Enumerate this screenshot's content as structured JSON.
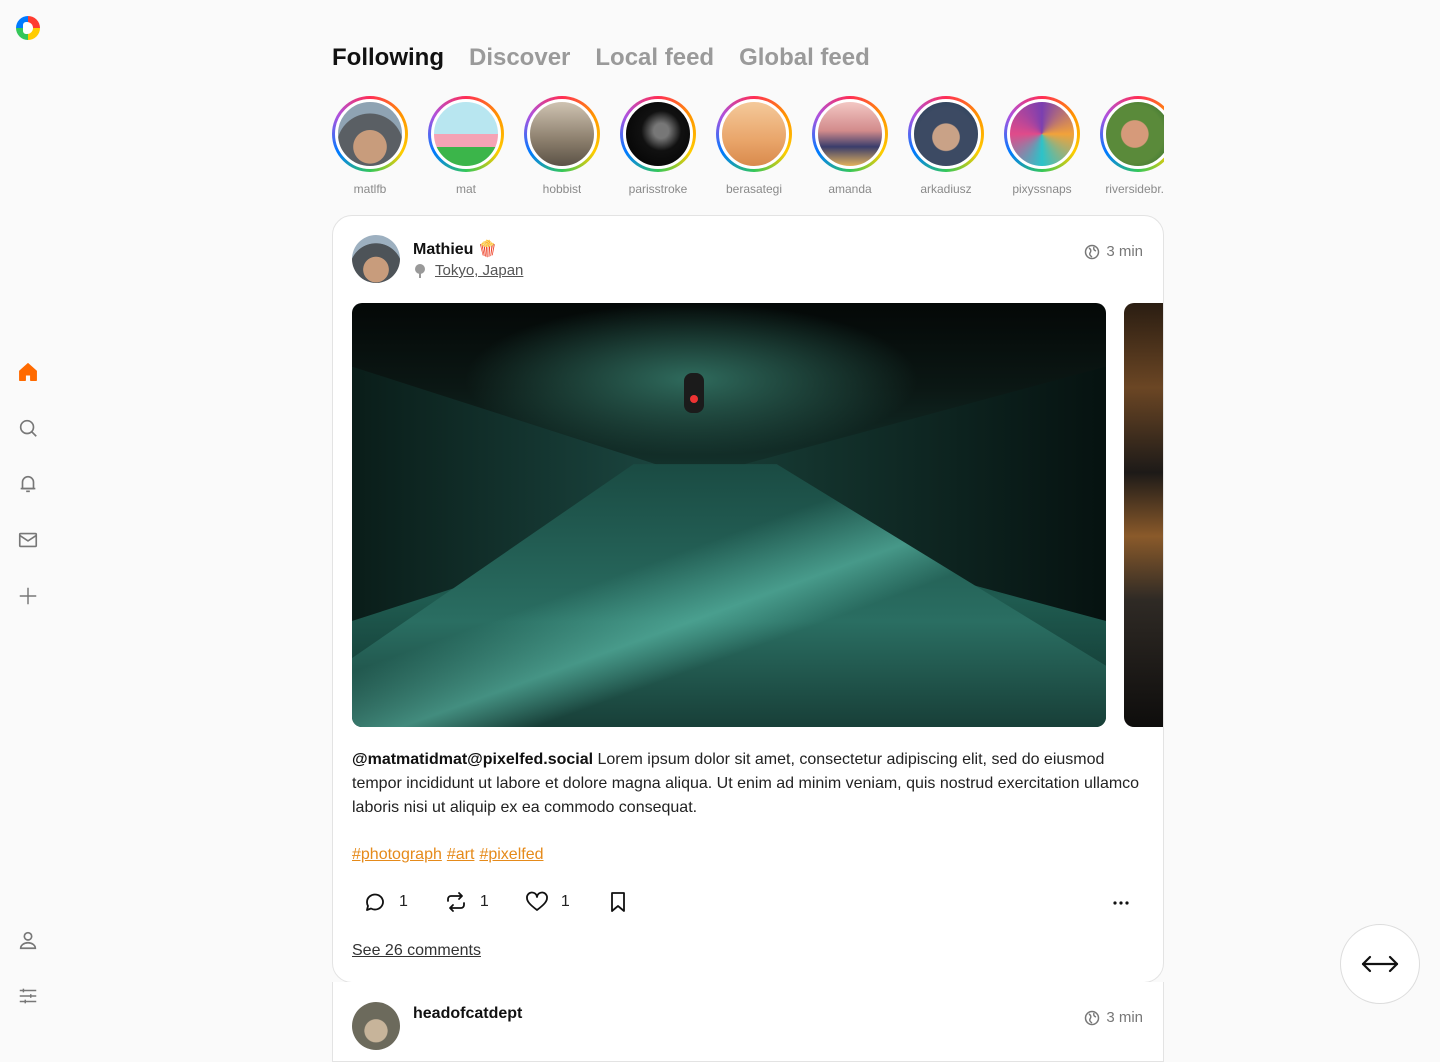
{
  "tabs": [
    "Following",
    "Discover",
    "Local feed",
    "Global feed"
  ],
  "stories": [
    {
      "name": "matlfb"
    },
    {
      "name": "mat"
    },
    {
      "name": "hobbist"
    },
    {
      "name": "parisstroke"
    },
    {
      "name": "berasategi"
    },
    {
      "name": "amanda"
    },
    {
      "name": "arkadiusz"
    },
    {
      "name": "pixyssnaps"
    },
    {
      "name": "riversidebr..."
    }
  ],
  "post": {
    "author": "Mathieu 🍿",
    "location": "Tokyo, Japan",
    "time": "3 min",
    "mention": "@matmatidmat@pixelfed.social",
    "text": " Lorem ipsum dolor sit amet, consectetur adipiscing elit, sed do eiusmod tempor incididunt ut labore et dolore magna aliqua. Ut enim ad minim veniam, quis nostrud exercitation ullamco laboris nisi ut aliquip ex ea commodo consequat.",
    "tags": [
      "#photograph",
      "#art",
      "#pixelfed"
    ],
    "replies": "1",
    "boosts": "1",
    "likes": "1",
    "comments_link": "See 26 comments"
  },
  "post2": {
    "author": "headofcatdept",
    "time": "3 min"
  },
  "colors": {
    "accent": "#ff6a00",
    "tag": "#e58a1a"
  }
}
